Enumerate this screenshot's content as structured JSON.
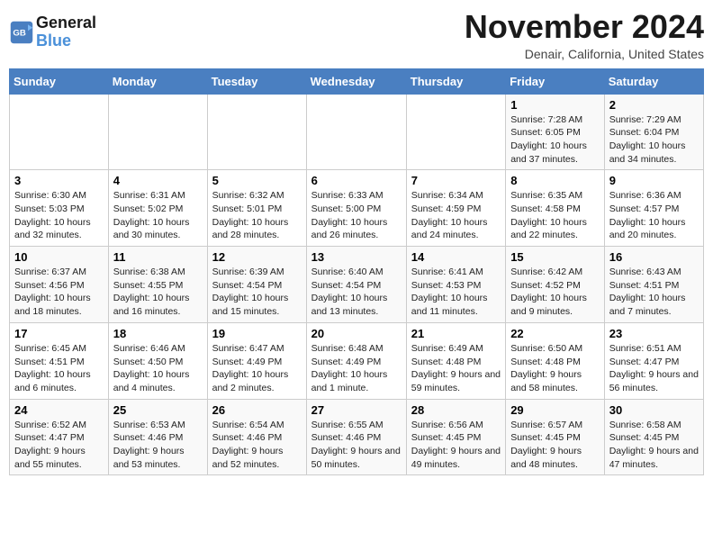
{
  "header": {
    "logo_line1": "General",
    "logo_line2": "Blue",
    "month_title": "November 2024",
    "location": "Denair, California, United States"
  },
  "weekdays": [
    "Sunday",
    "Monday",
    "Tuesday",
    "Wednesday",
    "Thursday",
    "Friday",
    "Saturday"
  ],
  "weeks": [
    [
      {
        "day": "",
        "info": ""
      },
      {
        "day": "",
        "info": ""
      },
      {
        "day": "",
        "info": ""
      },
      {
        "day": "",
        "info": ""
      },
      {
        "day": "",
        "info": ""
      },
      {
        "day": "1",
        "info": "Sunrise: 7:28 AM\nSunset: 6:05 PM\nDaylight: 10 hours and 37 minutes."
      },
      {
        "day": "2",
        "info": "Sunrise: 7:29 AM\nSunset: 6:04 PM\nDaylight: 10 hours and 34 minutes."
      }
    ],
    [
      {
        "day": "3",
        "info": "Sunrise: 6:30 AM\nSunset: 5:03 PM\nDaylight: 10 hours and 32 minutes."
      },
      {
        "day": "4",
        "info": "Sunrise: 6:31 AM\nSunset: 5:02 PM\nDaylight: 10 hours and 30 minutes."
      },
      {
        "day": "5",
        "info": "Sunrise: 6:32 AM\nSunset: 5:01 PM\nDaylight: 10 hours and 28 minutes."
      },
      {
        "day": "6",
        "info": "Sunrise: 6:33 AM\nSunset: 5:00 PM\nDaylight: 10 hours and 26 minutes."
      },
      {
        "day": "7",
        "info": "Sunrise: 6:34 AM\nSunset: 4:59 PM\nDaylight: 10 hours and 24 minutes."
      },
      {
        "day": "8",
        "info": "Sunrise: 6:35 AM\nSunset: 4:58 PM\nDaylight: 10 hours and 22 minutes."
      },
      {
        "day": "9",
        "info": "Sunrise: 6:36 AM\nSunset: 4:57 PM\nDaylight: 10 hours and 20 minutes."
      }
    ],
    [
      {
        "day": "10",
        "info": "Sunrise: 6:37 AM\nSunset: 4:56 PM\nDaylight: 10 hours and 18 minutes."
      },
      {
        "day": "11",
        "info": "Sunrise: 6:38 AM\nSunset: 4:55 PM\nDaylight: 10 hours and 16 minutes."
      },
      {
        "day": "12",
        "info": "Sunrise: 6:39 AM\nSunset: 4:54 PM\nDaylight: 10 hours and 15 minutes."
      },
      {
        "day": "13",
        "info": "Sunrise: 6:40 AM\nSunset: 4:54 PM\nDaylight: 10 hours and 13 minutes."
      },
      {
        "day": "14",
        "info": "Sunrise: 6:41 AM\nSunset: 4:53 PM\nDaylight: 10 hours and 11 minutes."
      },
      {
        "day": "15",
        "info": "Sunrise: 6:42 AM\nSunset: 4:52 PM\nDaylight: 10 hours and 9 minutes."
      },
      {
        "day": "16",
        "info": "Sunrise: 6:43 AM\nSunset: 4:51 PM\nDaylight: 10 hours and 7 minutes."
      }
    ],
    [
      {
        "day": "17",
        "info": "Sunrise: 6:45 AM\nSunset: 4:51 PM\nDaylight: 10 hours and 6 minutes."
      },
      {
        "day": "18",
        "info": "Sunrise: 6:46 AM\nSunset: 4:50 PM\nDaylight: 10 hours and 4 minutes."
      },
      {
        "day": "19",
        "info": "Sunrise: 6:47 AM\nSunset: 4:49 PM\nDaylight: 10 hours and 2 minutes."
      },
      {
        "day": "20",
        "info": "Sunrise: 6:48 AM\nSunset: 4:49 PM\nDaylight: 10 hours and 1 minute."
      },
      {
        "day": "21",
        "info": "Sunrise: 6:49 AM\nSunset: 4:48 PM\nDaylight: 9 hours and 59 minutes."
      },
      {
        "day": "22",
        "info": "Sunrise: 6:50 AM\nSunset: 4:48 PM\nDaylight: 9 hours and 58 minutes."
      },
      {
        "day": "23",
        "info": "Sunrise: 6:51 AM\nSunset: 4:47 PM\nDaylight: 9 hours and 56 minutes."
      }
    ],
    [
      {
        "day": "24",
        "info": "Sunrise: 6:52 AM\nSunset: 4:47 PM\nDaylight: 9 hours and 55 minutes."
      },
      {
        "day": "25",
        "info": "Sunrise: 6:53 AM\nSunset: 4:46 PM\nDaylight: 9 hours and 53 minutes."
      },
      {
        "day": "26",
        "info": "Sunrise: 6:54 AM\nSunset: 4:46 PM\nDaylight: 9 hours and 52 minutes."
      },
      {
        "day": "27",
        "info": "Sunrise: 6:55 AM\nSunset: 4:46 PM\nDaylight: 9 hours and 50 minutes."
      },
      {
        "day": "28",
        "info": "Sunrise: 6:56 AM\nSunset: 4:45 PM\nDaylight: 9 hours and 49 minutes."
      },
      {
        "day": "29",
        "info": "Sunrise: 6:57 AM\nSunset: 4:45 PM\nDaylight: 9 hours and 48 minutes."
      },
      {
        "day": "30",
        "info": "Sunrise: 6:58 AM\nSunset: 4:45 PM\nDaylight: 9 hours and 47 minutes."
      }
    ]
  ]
}
